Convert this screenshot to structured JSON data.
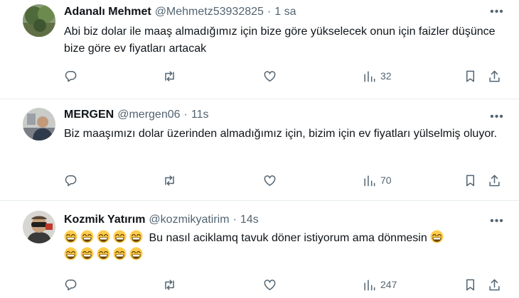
{
  "tweets": [
    {
      "name": "Adanalı Mehmet",
      "handle": "@Mehmetz53932825",
      "separator": "·",
      "time": "1 sa",
      "text": "Abi biz dolar ile maaş almadığımız için bize göre yükselecek onun için faizler düşünce bize göre ev fiyatları artacak",
      "views": "32"
    },
    {
      "name": "MERGEN",
      "handle": "@mergen06",
      "separator": "·",
      "time": "11s",
      "text": "Biz maaşımızı dolar üzerinden almadığımız için, bizim için ev fiyatları yülselmiş oluyor.",
      "views": "70"
    },
    {
      "name": "Kozmik Yatırım",
      "handle": "@kozmikyatirim",
      "separator": "·",
      "time": "14s",
      "text": "Bu nasıl aciklamq tavuk döner istiyorum ama dönmesin",
      "views": "247"
    }
  ],
  "icons": {
    "more": "more-icon",
    "reply": "reply-icon",
    "retweet": "retweet-icon",
    "like": "heart-icon",
    "views": "views-icon",
    "bookmark": "bookmark-icon",
    "share": "share-icon",
    "emoji": "grinning-face-emoji"
  },
  "colors": {
    "text": "#0f1419",
    "secondary": "#536471",
    "divider": "#e6ecf0",
    "emoji_face": "#ffcc4d"
  }
}
